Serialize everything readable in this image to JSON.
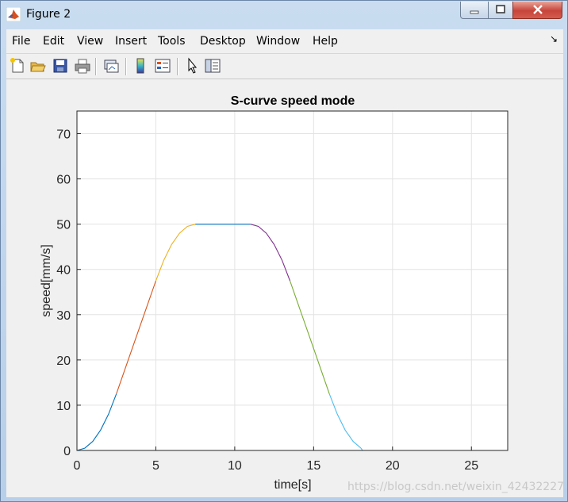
{
  "window": {
    "title": "Figure 2",
    "controls": [
      "minimize-icon",
      "maximize-icon",
      "close-icon"
    ]
  },
  "menu": {
    "items": [
      "File",
      "Edit",
      "View",
      "Insert",
      "Tools",
      "Desktop",
      "Window",
      "Help"
    ],
    "overflow_icon": "dock-arrow-icon"
  },
  "toolbar": {
    "icons": [
      "new-figure-icon",
      "open-file-icon",
      "save-icon",
      "print-icon",
      "link-plot-icon",
      "insert-colorbar-icon",
      "insert-legend-icon",
      "edit-plot-icon",
      "property-inspector-icon"
    ]
  },
  "watermark": "https://blog.csdn.net/weixin_42432227",
  "chart_data": {
    "type": "line",
    "title": "S-curve speed mode",
    "xlabel": "time[s]",
    "ylabel": "speed[mm/s]",
    "xlim": [
      0,
      27.3
    ],
    "ylim": [
      0,
      75
    ],
    "xticks": [
      0,
      5,
      10,
      15,
      20,
      25
    ],
    "yticks": [
      0,
      10,
      20,
      30,
      40,
      50,
      60,
      70
    ],
    "grid": true,
    "series": [
      {
        "color": "#0072BD",
        "x": [
          0,
          0.5,
          1.0,
          1.5,
          2.0,
          2.5
        ],
        "y": [
          0,
          0.5,
          2.0,
          4.5,
          8.0,
          12.5
        ]
      },
      {
        "color": "#D95319",
        "x": [
          2.5,
          3.5,
          5.0
        ],
        "y": [
          12.5,
          22.5,
          37.5
        ]
      },
      {
        "color": "#EDB120",
        "x": [
          5.0,
          5.5,
          6.0,
          6.5,
          7.0,
          7.5
        ],
        "y": [
          37.5,
          42.0,
          45.5,
          48.0,
          49.5,
          50.0
        ]
      },
      {
        "color": "#0072BD",
        "x": [
          7.5,
          11.0
        ],
        "y": [
          50.0,
          50.0
        ]
      },
      {
        "color": "#7E2F8E",
        "x": [
          11.0,
          11.5,
          12.0,
          12.5,
          13.0,
          13.5
        ],
        "y": [
          50.0,
          49.5,
          48.0,
          45.5,
          42.0,
          37.5
        ]
      },
      {
        "color": "#77AC30",
        "x": [
          13.5,
          15.0,
          16.0
        ],
        "y": [
          37.5,
          22.5,
          12.5
        ]
      },
      {
        "color": "#4DBEEE",
        "x": [
          16.0,
          16.5,
          17.0,
          17.5,
          18.0
        ],
        "y": [
          12.5,
          8.0,
          4.5,
          2.0,
          0.5
        ]
      },
      {
        "color": "#4DBEEE",
        "x": [
          18.0,
          18.1
        ],
        "y": [
          0.5,
          0
        ]
      }
    ]
  }
}
